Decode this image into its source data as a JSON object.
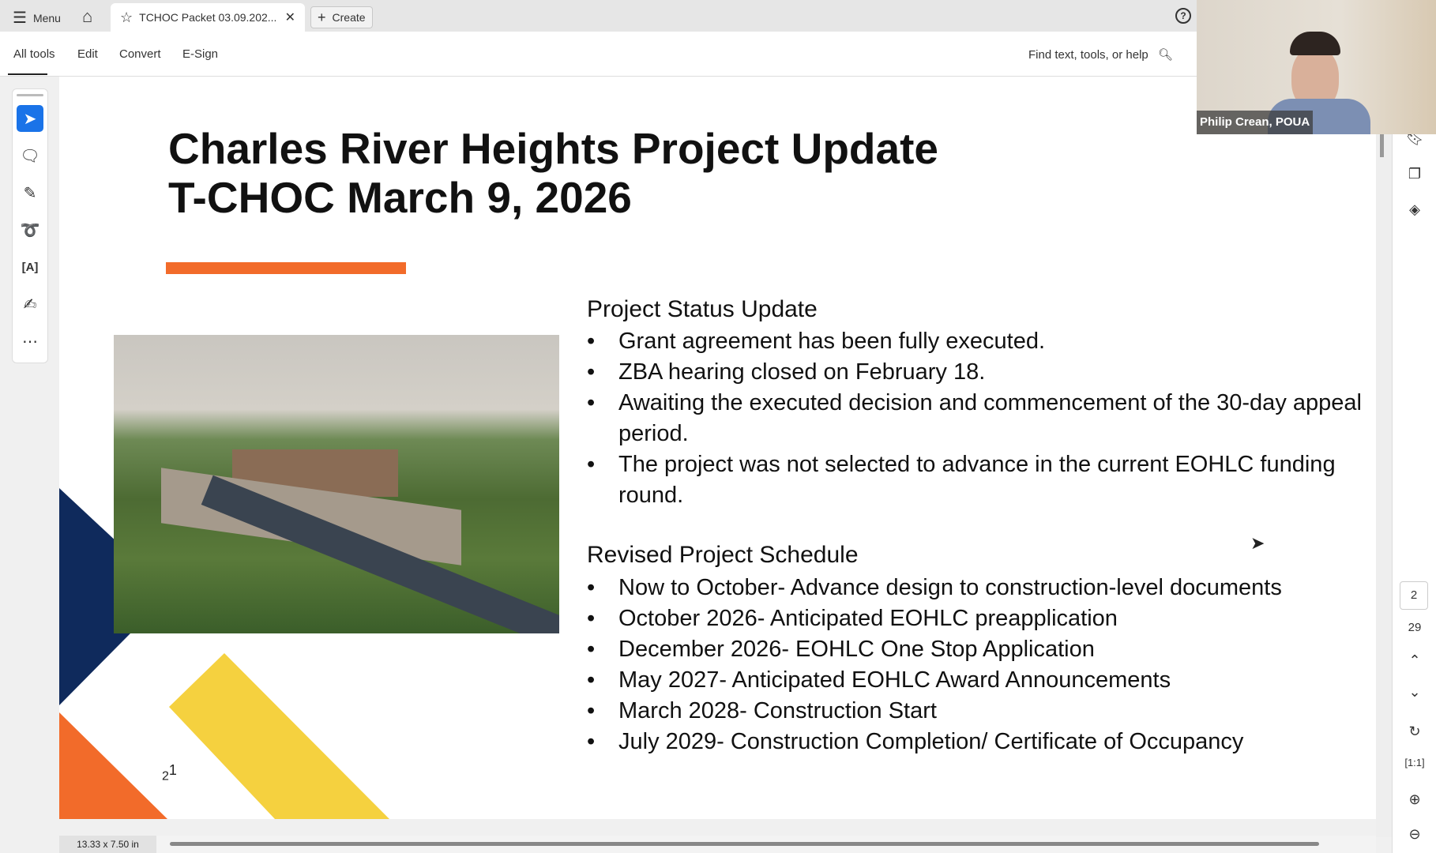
{
  "tabbar": {
    "menu": "Menu",
    "tab_title": "TCHOC Packet 03.09.202...",
    "create": "Create",
    "help": "?"
  },
  "toolbar": {
    "items": [
      "All tools",
      "Edit",
      "Convert",
      "E-Sign"
    ],
    "search_placeholder": "Find text, tools, or help"
  },
  "slide": {
    "title_line1": "Charles River Heights Project Update",
    "title_line2": "T-CHOC March 9, 2026",
    "status_heading": "Project Status Update",
    "status_items": [
      "Grant agreement has been fully executed.",
      "ZBA hearing closed on February 18.",
      "Awaiting the executed decision and commencement of the 30-day appeal period.",
      "The project was not selected to advance in the current EOHLC funding round."
    ],
    "schedule_heading": "Revised Project Schedule",
    "schedule_items": [
      "Now to October- Advance design to construction-level documents",
      "October 2026- Anticipated EOHLC preapplication",
      "December 2026- EOHLC One Stop Application",
      "May 2027- Anticipated EOHLC Award Announcements",
      "March 2028- Construction Start",
      "July 2029- Construction Completion/ Certificate of Occupancy"
    ],
    "page_num_sub": "2",
    "page_num_sup": "1",
    "colors": {
      "orange": "#f26b2a",
      "navy": "#0f2a5c",
      "yellow": "#f5d13f"
    }
  },
  "nav": {
    "current_page": "2",
    "total_pages": "29"
  },
  "video": {
    "name": "Philip Crean, POUA"
  },
  "status": {
    "page_size": "13.33 x 7.50 in"
  }
}
